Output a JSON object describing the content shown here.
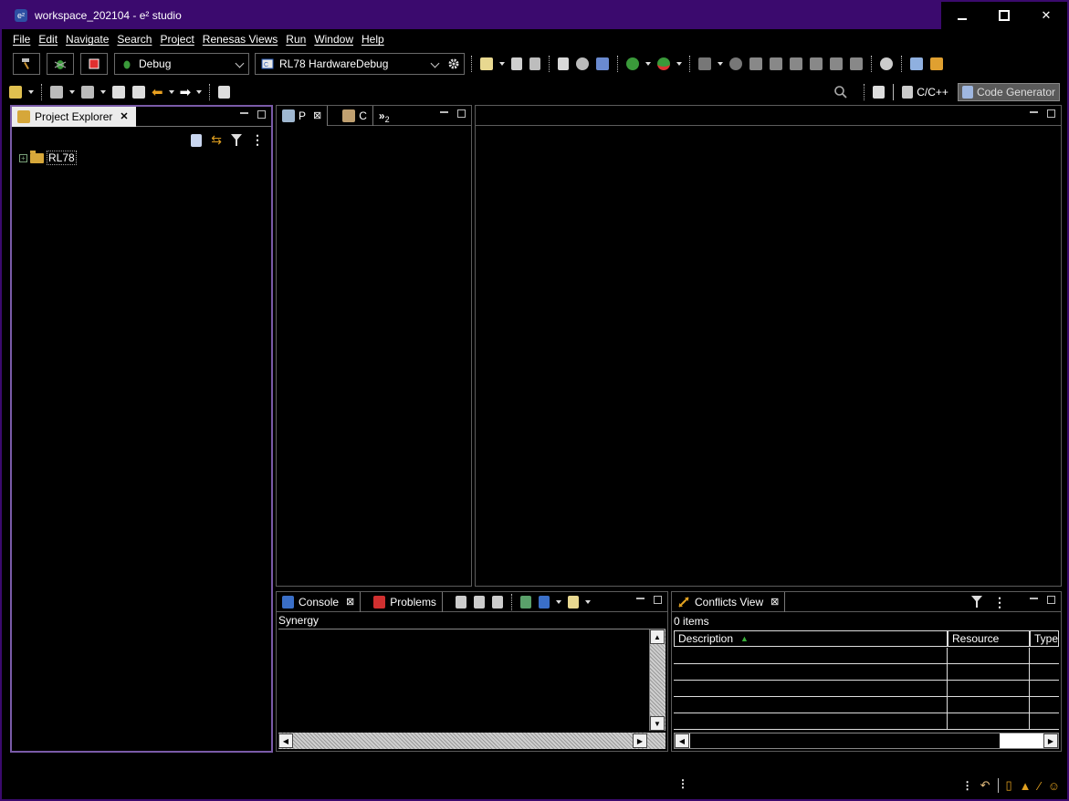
{
  "window": {
    "title": "workspace_202104 - e² studio",
    "app_icon": "e²",
    "controls": [
      "minimize",
      "maximize",
      "close"
    ],
    "close_glyph": "✕"
  },
  "menu": [
    "File",
    "Edit",
    "Navigate",
    "Search",
    "Project",
    "Renesas Views",
    "Run",
    "Window",
    "Help"
  ],
  "toolbar": {
    "launch_mode": "Debug",
    "launch_config": "RL78 HardwareDebug"
  },
  "perspectives": {
    "cpp": "C/C++",
    "codegen": "Code Generator"
  },
  "project_explorer": {
    "tab_label": "Project Explorer",
    "close_glyph": "✕",
    "tree": [
      {
        "label": "RL78",
        "expander": "+"
      }
    ]
  },
  "middle_panel": {
    "tab1": "P",
    "tab2": "C",
    "overflow": "»",
    "overflow_count": "2",
    "close_glyph": "⊠"
  },
  "console_panel": {
    "tab_console": "Console",
    "tab_problems": "Problems",
    "close_glyph": "⊠",
    "console_name": "Synergy"
  },
  "conflicts_panel": {
    "tab_label": "Conflicts View",
    "close_glyph": "⊠",
    "item_count": "0 items",
    "columns": [
      "Description",
      "Resource",
      "Type"
    ],
    "sort_glyph": "▲"
  },
  "colors": {
    "accent_purple": "#3b0a6e",
    "focus_border": "#7a5ba8",
    "background": "#000000"
  }
}
